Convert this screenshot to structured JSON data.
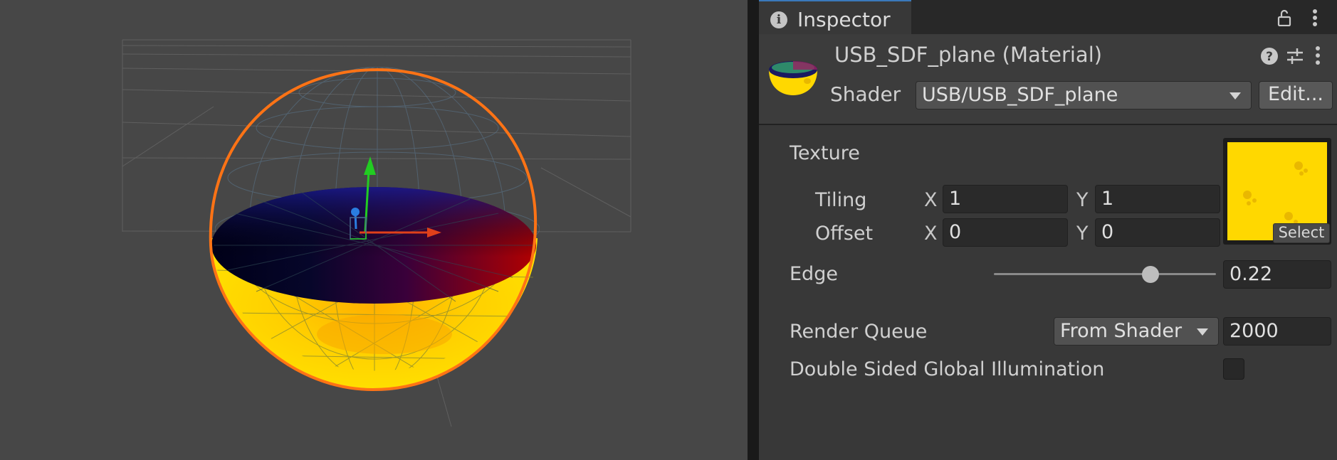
{
  "tab": {
    "label": "Inspector"
  },
  "material": {
    "title": "USB_SDF_plane (Material)"
  },
  "shader": {
    "label": "Shader",
    "value": "USB/USB_SDF_plane",
    "edit_label": "Edit..."
  },
  "properties": {
    "texture_label": "Texture",
    "tiling": {
      "label": "Tiling",
      "x_axis": "X",
      "x": "1",
      "y_axis": "Y",
      "y": "1"
    },
    "offset": {
      "label": "Offset",
      "x_axis": "X",
      "x": "0",
      "y_axis": "Y",
      "y": "0"
    },
    "select_label": "Select",
    "edge": {
      "label": "Edge",
      "value": "0.22",
      "slider_fraction": 0.7
    },
    "render_queue": {
      "label": "Render Queue",
      "mode": "From Shader",
      "value": "2000"
    },
    "double_sided_gi": {
      "label": "Double Sided Global Illumination",
      "checked": false
    }
  },
  "colors": {
    "accent": "#3a79bb",
    "texture_yellow": "#ffd800",
    "selection_outline": "#ff7315"
  },
  "icons": [
    "info-icon",
    "lock-icon",
    "kebab-menu-icon",
    "help-icon",
    "preset-icon",
    "material-preview-icon",
    "dropdown-arrow-icon"
  ]
}
